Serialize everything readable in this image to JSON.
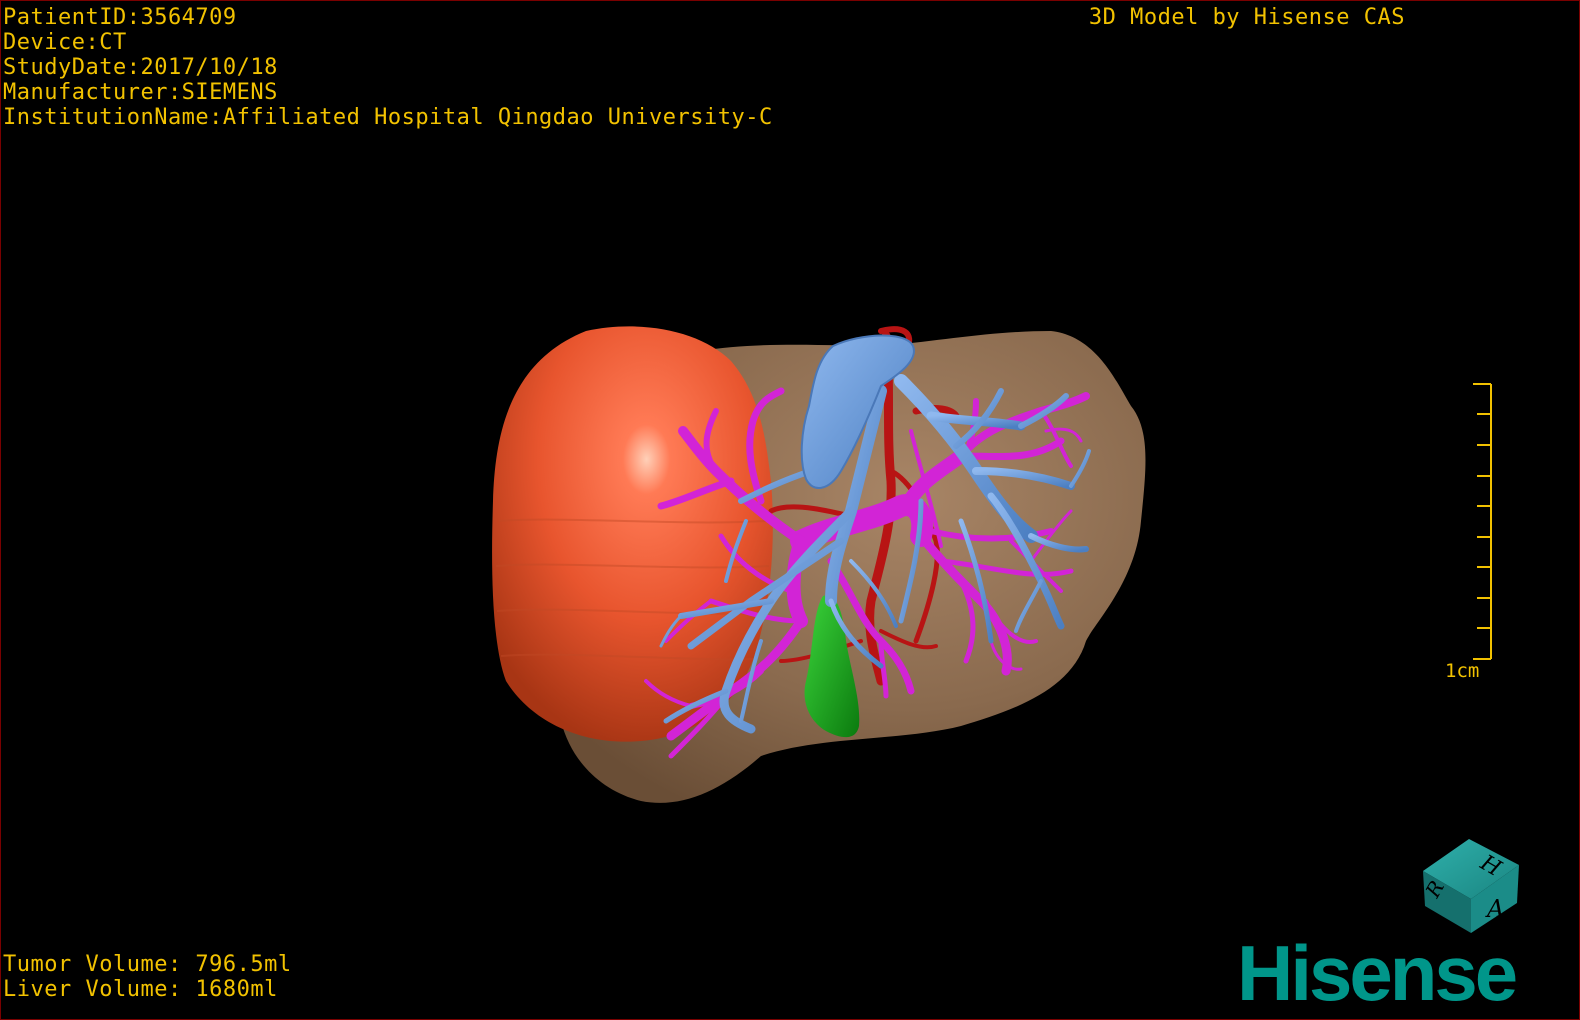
{
  "study_info": {
    "patient_id": "PatientID:3564709",
    "device": "Device:CT",
    "study_date": "StudyDate:2017/10/18",
    "manufacturer": "Manufacturer:SIEMENS",
    "institution": "InstitutionName:Affiliated Hospital Qingdao University-C"
  },
  "brand_text": "3D Model by Hisense CAS",
  "volumes": {
    "tumor": "Tumor Volume: 796.5ml",
    "liver": "Liver Volume: 1680ml"
  },
  "scale_bar": {
    "label": "1cm"
  },
  "orientation_cube": {
    "labels": [
      "H",
      "A",
      "R"
    ],
    "color": "#1f8f8c"
  },
  "logo_text": "Hisense",
  "colors": {
    "hud_text": "#f2c200",
    "liver": "#8c6a4e",
    "tumor": "#e85a35",
    "portal_vein": "#d224d6",
    "hepatic_vein": "#6f9fd8",
    "artery": "#b81414",
    "gallbladder": "#17a81a",
    "logo": "#00968a"
  }
}
